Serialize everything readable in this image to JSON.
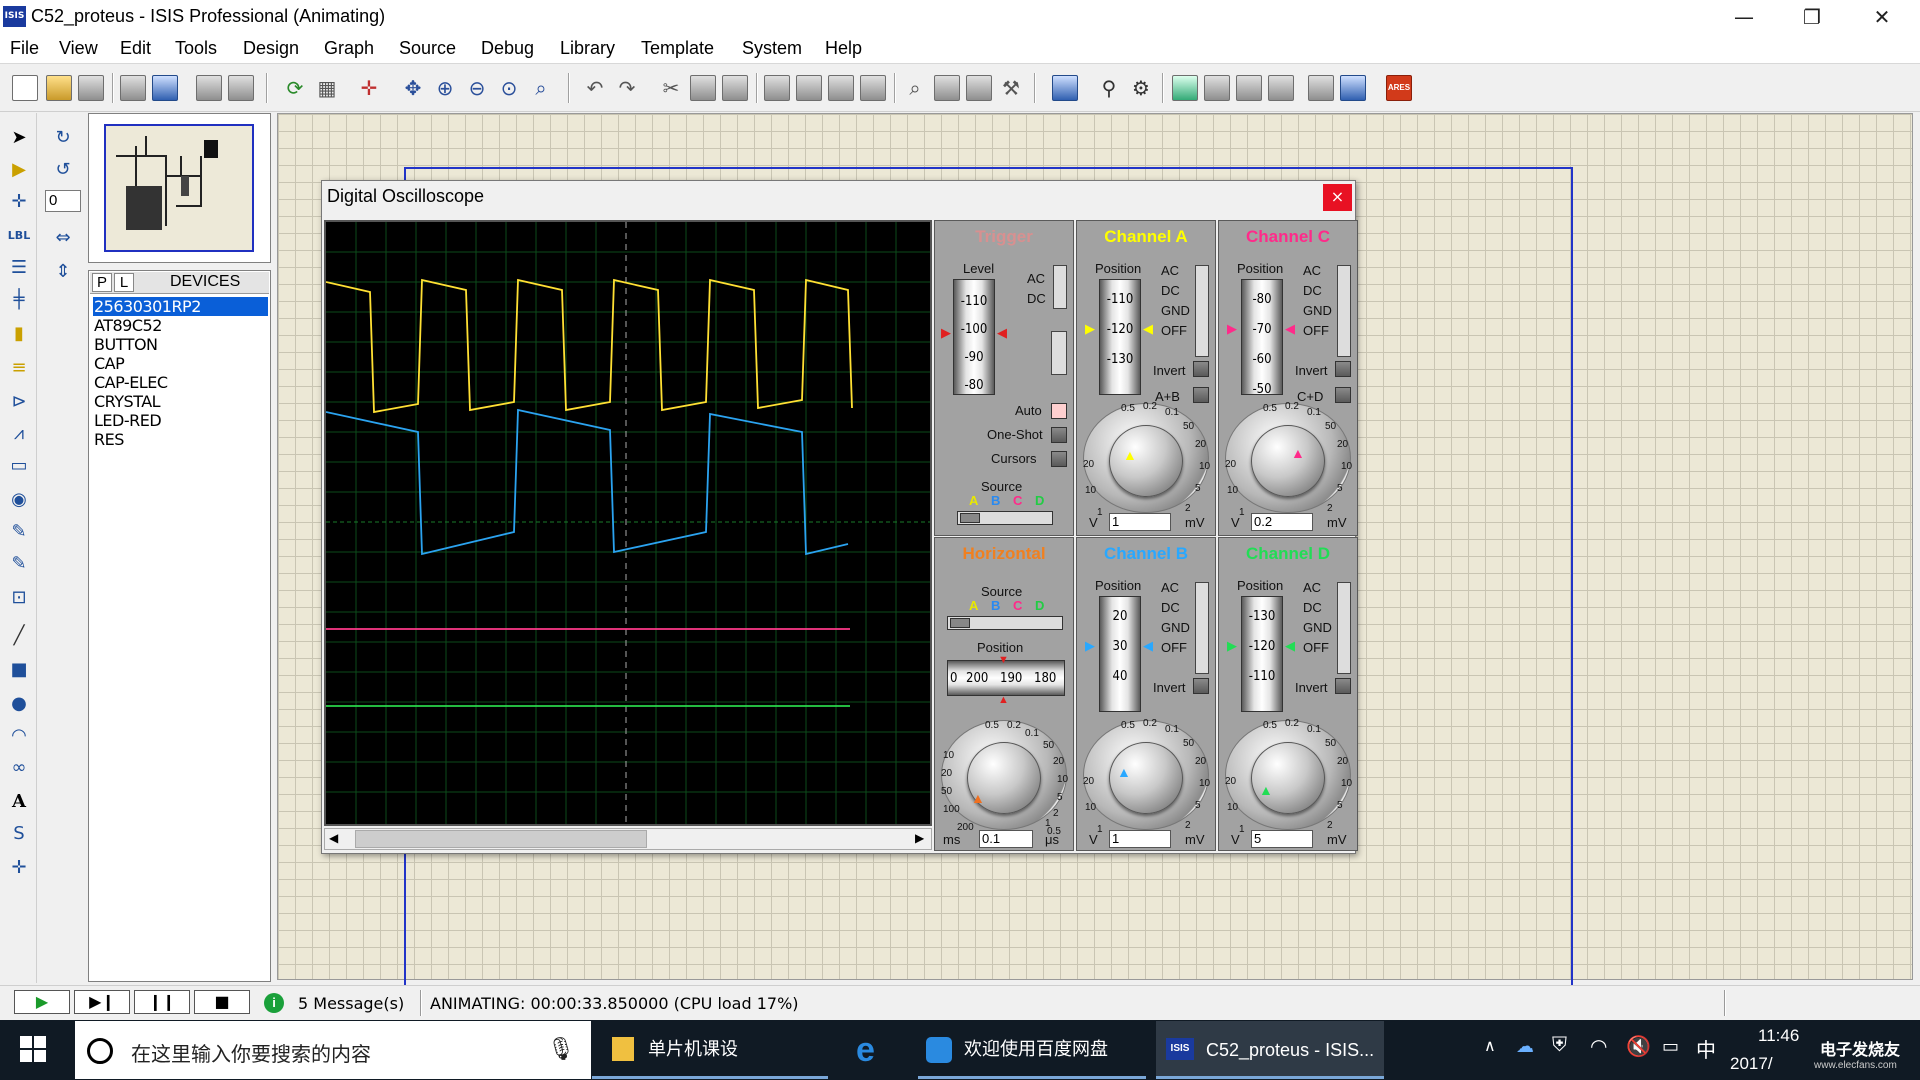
{
  "window": {
    "title": "C52_proteus - ISIS Professional (Animating)",
    "app_icon": "ISIS",
    "minimize": "—",
    "restore": "❐",
    "close": "✕"
  },
  "menu": [
    "File",
    "View",
    "Edit",
    "Tools",
    "Design",
    "Graph",
    "Source",
    "Debug",
    "Library",
    "Template",
    "System",
    "Help"
  ],
  "left_tools": {
    "rotation_value": "0"
  },
  "devices": {
    "tab_p": "P",
    "tab_l": "L",
    "title": "DEVICES",
    "items": [
      "25630301RP2",
      "AT89C52",
      "BUTTON",
      "CAP",
      "CAP-ELEC",
      "CRYSTAL",
      "LED-RED",
      "RES"
    ],
    "selected_index": 0
  },
  "oscilloscope": {
    "title": "Digital Oscilloscope",
    "close": "×",
    "trigger": {
      "title": "Trigger",
      "level_label": "Level",
      "level_values": [
        "-110",
        "-100",
        "-90",
        "-80"
      ],
      "ac": "AC",
      "dc": "DC",
      "auto": "Auto",
      "one_shot": "One-Shot",
      "cursors": "Cursors",
      "source_label": "Source",
      "sources": [
        "A",
        "B",
        "C",
        "D"
      ]
    },
    "horizontal": {
      "title": "Horizontal",
      "source_label": "Source",
      "sources": [
        "A",
        "B",
        "C",
        "D"
      ],
      "position_label": "Position",
      "position_values": [
        "0",
        "200",
        "190",
        "180"
      ],
      "value": "0.1",
      "unit_left": "ms",
      "unit_right": "μs",
      "dial_ticks": [
        "0.5",
        "0.2",
        "0.1",
        "50",
        "20",
        "10",
        "5",
        "2",
        "1",
        "0.5",
        "200",
        "100",
        "50",
        "20",
        "10"
      ]
    },
    "channels": [
      {
        "title": "Channel A",
        "color": "#ffff00",
        "position_label": "Position",
        "values": [
          "-110",
          "-120",
          "-130"
        ],
        "coupling": [
          "AC",
          "DC",
          "GND",
          "OFF"
        ],
        "invert": "Invert",
        "combine": "A+B",
        "value": "1",
        "unit_left": "V",
        "unit_right": "mV"
      },
      {
        "title": "Channel C",
        "color": "#ff2a8a",
        "position_label": "Position",
        "values": [
          "-80",
          "-70",
          "-60",
          "-50"
        ],
        "coupling": [
          "AC",
          "DC",
          "GND",
          "OFF"
        ],
        "invert": "Invert",
        "combine": "C+D",
        "value": "0.2",
        "unit_left": "V",
        "unit_right": "mV"
      },
      {
        "title": "Channel B",
        "color": "#29a8ff",
        "position_label": "Position",
        "values": [
          "20",
          "30",
          "40"
        ],
        "coupling": [
          "AC",
          "DC",
          "GND",
          "OFF"
        ],
        "invert": "Invert",
        "value": "1",
        "unit_left": "V",
        "unit_right": "mV"
      },
      {
        "title": "Channel D",
        "color": "#22dd55",
        "position_label": "Position",
        "values": [
          "-130",
          "-120",
          "-110"
        ],
        "coupling": [
          "AC",
          "DC",
          "GND",
          "OFF"
        ],
        "invert": "Invert",
        "value": "5",
        "unit_left": "V",
        "unit_right": "mV"
      }
    ],
    "dial_ticks": [
      "0.5",
      "0.2",
      "0.1",
      "50",
      "20",
      "10",
      "5",
      "2",
      "1",
      "10",
      "20"
    ]
  },
  "status": {
    "messages": "5 Message(s)",
    "animating": "ANIMATING: 00:00:33.850000 (CPU load 17%)"
  },
  "taskbar": {
    "search_placeholder": "在这里输入你要搜索的内容",
    "apps": [
      "单片机课设",
      "欢迎使用百度网盘",
      "C52_proteus - ISIS..."
    ],
    "time": "11:46",
    "date": "2017/",
    "ime": "中",
    "watermark": "电子发烧友",
    "watermark_url": "www.elecfans.com"
  }
}
